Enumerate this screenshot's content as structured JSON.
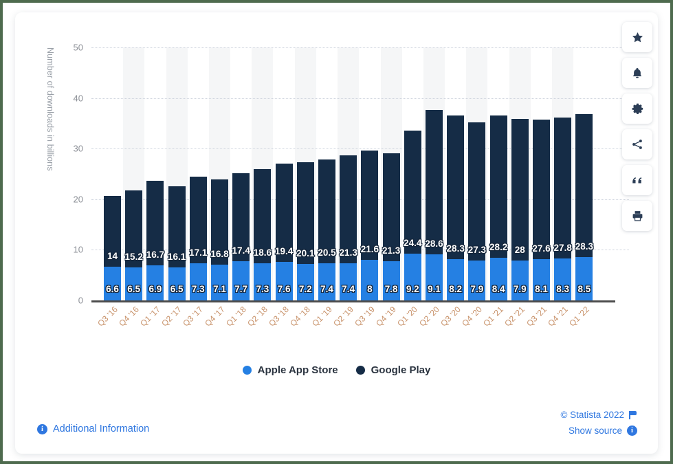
{
  "chart_data": {
    "type": "bar",
    "stacked": true,
    "title": "",
    "xlabel": "",
    "ylabel": "Number of downloads in billions",
    "ylim": [
      0,
      50
    ],
    "yticks": [
      0,
      10,
      20,
      30,
      40,
      50
    ],
    "grid": true,
    "legend_position": "bottom",
    "categories": [
      "Q3 '16",
      "Q4 '16",
      "Q1 '17",
      "Q2 '17",
      "Q3 '17",
      "Q4 '17",
      "Q1 '18",
      "Q2 '18",
      "Q3 '18",
      "Q4 '18",
      "Q1 '19",
      "Q2 '19",
      "Q3 '19",
      "Q4 '19",
      "Q1 '20",
      "Q2 '20",
      "Q3 '20",
      "Q4 '20",
      "Q1 '21",
      "Q2 '21",
      "Q3 '21",
      "Q4 '21",
      "Q1 '22"
    ],
    "series": [
      {
        "name": "Apple App Store",
        "color": "#2580e3",
        "values": [
          6.6,
          6.5,
          6.9,
          6.5,
          7.3,
          7.1,
          7.7,
          7.3,
          7.6,
          7.2,
          7.4,
          7.4,
          8,
          7.8,
          9.2,
          9.1,
          8.2,
          7.9,
          8.4,
          7.9,
          8.1,
          8.3,
          8.5
        ],
        "labels": [
          "6.6",
          "6.5",
          "6.9",
          "6.5",
          "7.3",
          "7.1",
          "7.7",
          "7.3",
          "7.6",
          "7.2",
          "7.4",
          "7.4",
          "8",
          "7.8",
          "9.2",
          "9.1",
          "8.2",
          "7.9",
          "8.4",
          "7.9",
          "8.1",
          "8.3",
          "8.5"
        ]
      },
      {
        "name": "Google Play",
        "color": "#152c46",
        "values": [
          14,
          15.2,
          16.7,
          16.1,
          17.1,
          16.8,
          17.4,
          18.6,
          19.4,
          20.1,
          20.5,
          21.3,
          21.6,
          21.3,
          24.4,
          28.6,
          28.3,
          27.3,
          28.2,
          28,
          27.6,
          27.8,
          28.3
        ],
        "labels": [
          "14",
          "15.2",
          "16.7",
          "16.1",
          "17.1",
          "16.8",
          "17.4",
          "18.6",
          "19.4",
          "20.1",
          "20.5",
          "21.3",
          "21.6",
          "21.3",
          "24.4",
          "28.6",
          "28.3",
          "27.3",
          "28.2",
          "28",
          "27.6",
          "27.8",
          "28.3"
        ]
      }
    ]
  },
  "legend": {
    "items": [
      {
        "label": "Apple App Store",
        "color": "#2580e3"
      },
      {
        "label": "Google Play",
        "color": "#152c46"
      }
    ]
  },
  "footer": {
    "additional_information": "Additional Information",
    "info_glyph": "i",
    "copyright": "© Statista 2022",
    "show_source": "Show source",
    "source_glyph": "i"
  },
  "toolbar": {
    "buttons": [
      {
        "name": "favorite-button",
        "icon": "star-icon"
      },
      {
        "name": "notify-button",
        "icon": "bell-icon"
      },
      {
        "name": "settings-button",
        "icon": "gear-icon"
      },
      {
        "name": "share-button",
        "icon": "share-icon"
      },
      {
        "name": "cite-button",
        "icon": "quote-icon"
      },
      {
        "name": "print-button",
        "icon": "printer-icon"
      }
    ]
  },
  "colors": {
    "apple": "#2580e3",
    "google": "#152c46",
    "accent_link": "#2f77e0",
    "axis_label": "#c8926a",
    "frame": "#4e6b4e"
  }
}
